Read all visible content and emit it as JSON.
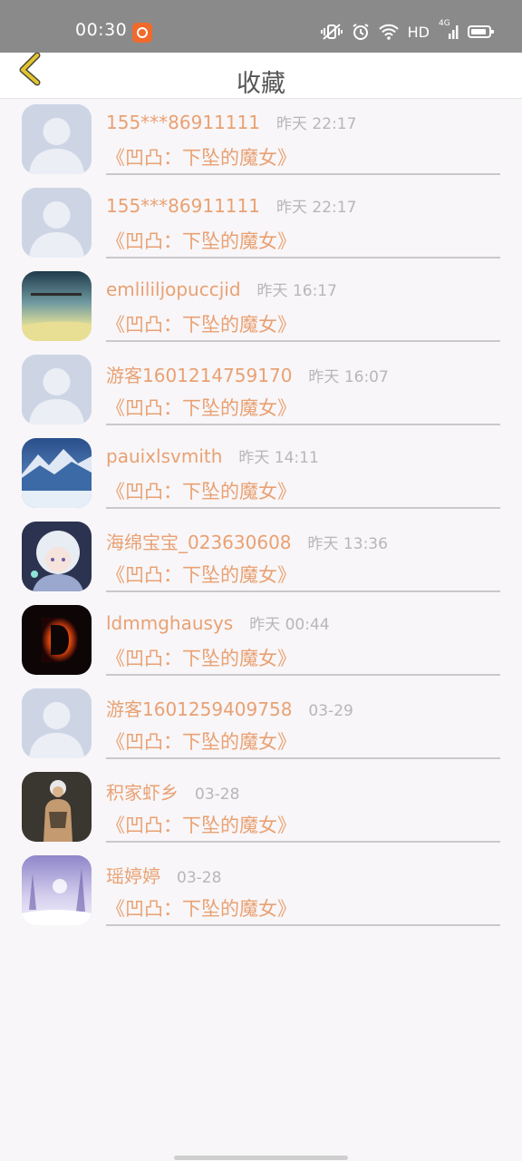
{
  "status_bar": {
    "time": "00:30",
    "network_label": "HD",
    "signal_label": "4G",
    "icons": [
      "app-notification-icon",
      "vibrate-mute-icon",
      "alarm-icon",
      "wifi-icon",
      "signal-icon",
      "battery-icon"
    ]
  },
  "header": {
    "title": "收藏",
    "back_icon": "chevron-left-icon"
  },
  "colors": {
    "accent": "#e9a173",
    "time_text": "#b7b7b7",
    "back_arrow": "#e3c430",
    "status_bar_bg": "#8a8a8a"
  },
  "favorites": [
    {
      "name": "155***86911111",
      "time": "昨天 22:17",
      "title": "《凹凸：下坠的魔女》",
      "avatar": "default"
    },
    {
      "name": "155***86911111",
      "time": "昨天 22:17",
      "title": "《凹凸：下坠的魔女》",
      "avatar": "default"
    },
    {
      "name": "emlililjopuccjid",
      "time": "昨天 16:17",
      "title": "《凹凸：下坠的魔女》",
      "avatar": "sky"
    },
    {
      "name": "游客1601214759170",
      "time": "昨天 16:07",
      "title": "《凹凸：下坠的魔女》",
      "avatar": "default"
    },
    {
      "name": "pauixlsvmith",
      "time": "昨天 14:11",
      "title": "《凹凸：下坠的魔女》",
      "avatar": "mountain"
    },
    {
      "name": "海绵宝宝_023630608",
      "time": "昨天 13:36",
      "title": "《凹凸：下坠的魔女》",
      "avatar": "anime"
    },
    {
      "name": "ldmmghausys",
      "time": "昨天 00:44",
      "title": "《凹凸：下坠的魔女》",
      "avatar": "fire-letter"
    },
    {
      "name": "游客1601259409758",
      "time": "03-29",
      "title": "《凹凸：下坠的魔女》",
      "avatar": "default"
    },
    {
      "name": "积家虾乡",
      "time": "03-28",
      "title": "《凹凸：下坠的魔女》",
      "avatar": "character"
    },
    {
      "name": "瑶婷婷",
      "time": "03-28",
      "title": "《凹凸：下坠的魔女》",
      "avatar": "winter"
    }
  ]
}
